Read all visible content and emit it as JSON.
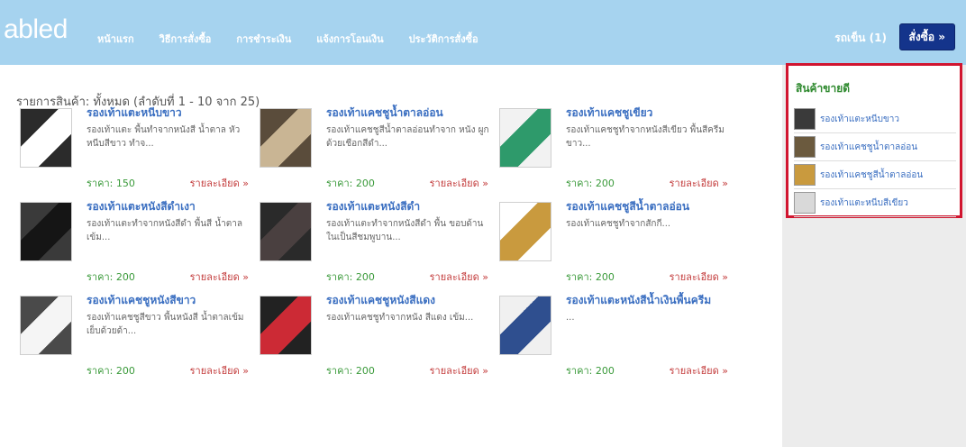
{
  "header": {
    "brand": "abled",
    "nav": [
      "หน้าแรก",
      "วิธีการสั่งซื้อ",
      "การชำระเงิน",
      "แจ้งการโอนเงิน",
      "ประวัติการสั่งซื้อ"
    ],
    "cart": "รถเข็น (1)",
    "order_button": "สั่งซื้อ »"
  },
  "listing": {
    "title": "รายการสินค้า: ทั้งหมด (ลำดับที่ 1 - 10 จาก 25)",
    "price_label": "ราคา:",
    "details_label": "รายละเอียด »",
    "products": [
      {
        "name": "รองเท้าแตะหนีบขาว",
        "desc": "รองเท้าแตะ พื้นทำจากหนังสี น้ำตาล หัวหนีบสีขาว ทำจ...",
        "price": "150",
        "colors": [
          "#2b2b2b",
          "#ffffff"
        ]
      },
      {
        "name": "รองเท้าแคชชูน้ำตาลอ่อน",
        "desc": "รองเท้าแคชชูสีน้ำตาลอ่อนทำจาก หนัง ผูกด้วยเชือกสีดำ...",
        "price": "200",
        "colors": [
          "#5a4c3b",
          "#c9b594"
        ]
      },
      {
        "name": "รองเท้าแคชชูเขียว",
        "desc": "รองเท้าแคชชูทำจากหนังสีเขียว พื้นสีครีมขาว...",
        "price": "200",
        "colors": [
          "#f2f2f2",
          "#2e9a6b"
        ]
      },
      {
        "name": "รองเท้าแตะหนังสีดำเงา",
        "desc": "รองเท้าแตะทำจากหนังสีดำ พื้นสี น้ำตาลเข้ม...",
        "price": "200",
        "colors": [
          "#3a3a3a",
          "#151515"
        ]
      },
      {
        "name": "รองเท้าแตะหนังสีดำ",
        "desc": "รองเท้าแตะทำจากหนังสีดำ พื้น ขอบด้านในเป็นสีชมพูบาน...",
        "price": "200",
        "colors": [
          "#2a2a2a",
          "#4a4040"
        ]
      },
      {
        "name": "รองเท้าแคชชูสีน้ำตาลอ่อน",
        "desc": "รองเท้าแคชชูทำจากสักกี...",
        "price": "200",
        "colors": [
          "#ffffff",
          "#c99a3e"
        ]
      },
      {
        "name": "รองเท้าแคชชูหนังสีขาว",
        "desc": "รองเท้าแคชชูสีขาว พื้นหนังสี น้ำตาลเข้ม เย็บด้วยด้า...",
        "price": "200",
        "colors": [
          "#4a4a4a",
          "#f5f5f5"
        ]
      },
      {
        "name": "รองเท้าแคชชูหนังสีแดง",
        "desc": "รองเท้าแคชชูทำจากหนัง สีแดง เข้ม...",
        "price": "200",
        "colors": [
          "#222222",
          "#cc2a35"
        ]
      },
      {
        "name": "รองเท้าแตะหนังสีน้ำเงินพื้นครีม",
        "desc": "...",
        "price": "200",
        "colors": [
          "#f0f0f0",
          "#2f4f8f"
        ]
      }
    ]
  },
  "bestsellers": {
    "title": "สินค้าขายดี",
    "items": [
      {
        "label": "รองเท้าแตะหนีบขาว",
        "color": "#3a3a3a"
      },
      {
        "label": "รองเท้าแคชชูน้ำตาลอ่อน",
        "color": "#6b5a3e"
      },
      {
        "label": "รองเท้าแคชชูสีน้ำตาลอ่อน",
        "color": "#c99a3e"
      },
      {
        "label": "รองเท้าแตะหนีบสีเขียว",
        "color": "#d9d9d9"
      }
    ]
  }
}
